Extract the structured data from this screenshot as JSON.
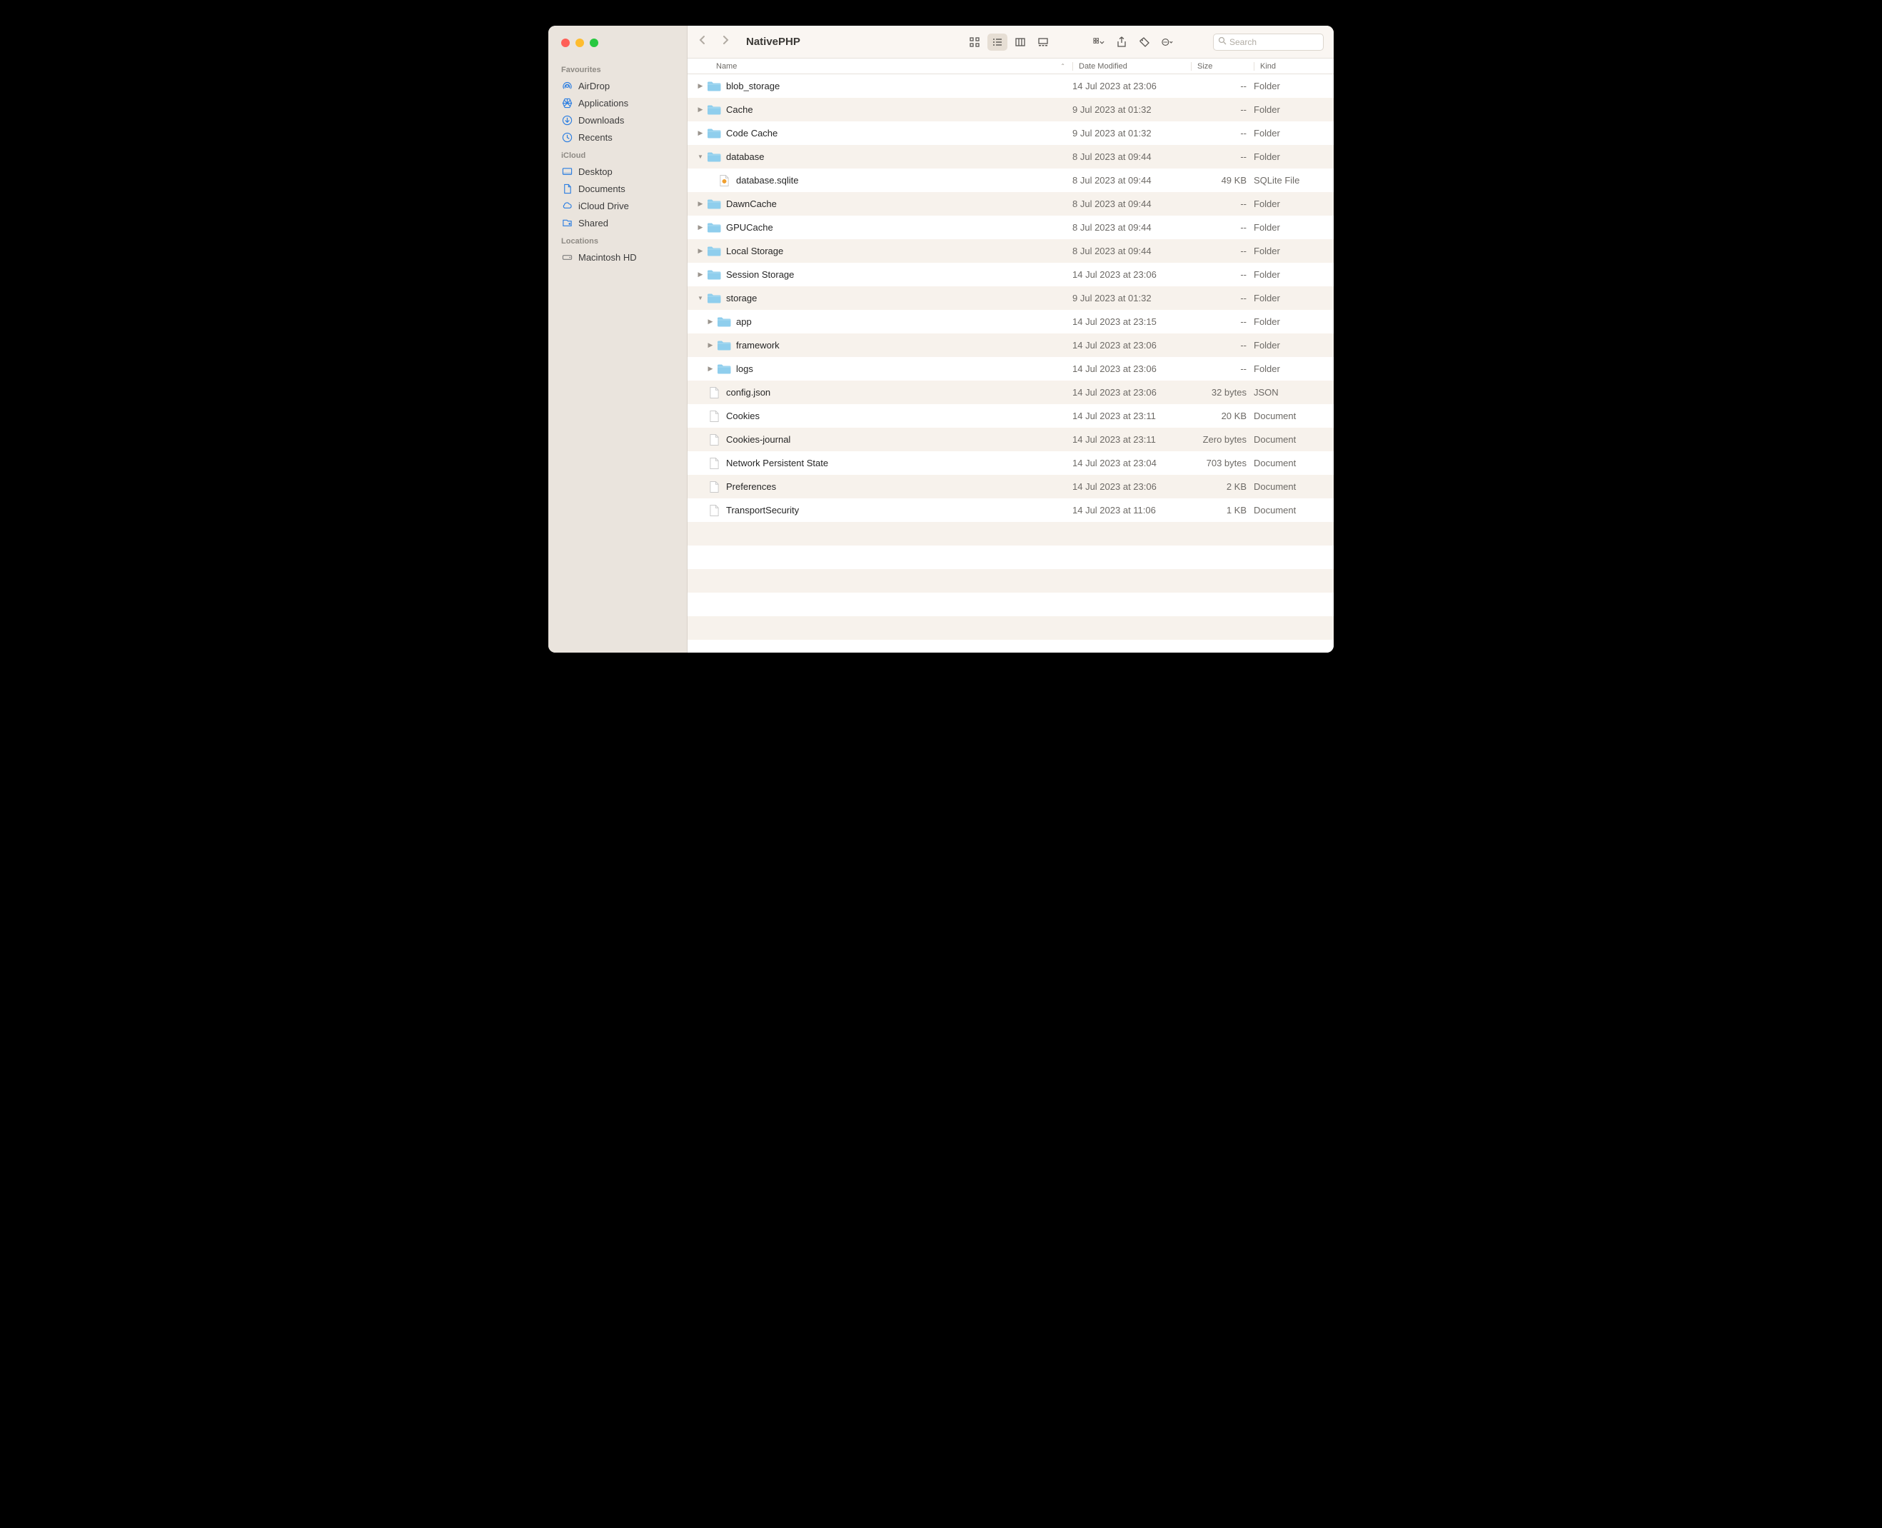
{
  "window": {
    "title": "NativePHP",
    "search_placeholder": "Search"
  },
  "sidebar": {
    "sections": [
      {
        "title": "Favourites",
        "items": [
          {
            "icon": "airdrop",
            "label": "AirDrop"
          },
          {
            "icon": "apps",
            "label": "Applications"
          },
          {
            "icon": "downloads",
            "label": "Downloads"
          },
          {
            "icon": "recents",
            "label": "Recents"
          }
        ]
      },
      {
        "title": "iCloud",
        "items": [
          {
            "icon": "desktop",
            "label": "Desktop"
          },
          {
            "icon": "documents",
            "label": "Documents"
          },
          {
            "icon": "icloud",
            "label": "iCloud Drive"
          },
          {
            "icon": "shared",
            "label": "Shared"
          }
        ]
      },
      {
        "title": "Locations",
        "items": [
          {
            "icon": "disk",
            "label": "Macintosh HD"
          }
        ]
      }
    ]
  },
  "columns": {
    "name": "Name",
    "date": "Date Modified",
    "size": "Size",
    "kind": "Kind"
  },
  "rows": [
    {
      "indent": 0,
      "expand": "closed",
      "icon": "folder",
      "name": "blob_storage",
      "date": "14 Jul 2023 at 23:06",
      "size": "--",
      "kind": "Folder"
    },
    {
      "indent": 0,
      "expand": "closed",
      "icon": "folder",
      "name": "Cache",
      "date": "9 Jul 2023 at 01:32",
      "size": "--",
      "kind": "Folder"
    },
    {
      "indent": 0,
      "expand": "closed",
      "icon": "folder",
      "name": "Code Cache",
      "date": "9 Jul 2023 at 01:32",
      "size": "--",
      "kind": "Folder"
    },
    {
      "indent": 0,
      "expand": "open",
      "icon": "folder",
      "name": "database",
      "date": "8 Jul 2023 at 09:44",
      "size": "--",
      "kind": "Folder"
    },
    {
      "indent": 1,
      "expand": "none",
      "icon": "sqlite",
      "name": "database.sqlite",
      "date": "8 Jul 2023 at 09:44",
      "size": "49 KB",
      "kind": "SQLite File"
    },
    {
      "indent": 0,
      "expand": "closed",
      "icon": "folder",
      "name": "DawnCache",
      "date": "8 Jul 2023 at 09:44",
      "size": "--",
      "kind": "Folder"
    },
    {
      "indent": 0,
      "expand": "closed",
      "icon": "folder",
      "name": "GPUCache",
      "date": "8 Jul 2023 at 09:44",
      "size": "--",
      "kind": "Folder"
    },
    {
      "indent": 0,
      "expand": "closed",
      "icon": "folder",
      "name": "Local Storage",
      "date": "8 Jul 2023 at 09:44",
      "size": "--",
      "kind": "Folder"
    },
    {
      "indent": 0,
      "expand": "closed",
      "icon": "folder",
      "name": "Session Storage",
      "date": "14 Jul 2023 at 23:06",
      "size": "--",
      "kind": "Folder"
    },
    {
      "indent": 0,
      "expand": "open",
      "icon": "folder",
      "name": "storage",
      "date": "9 Jul 2023 at 01:32",
      "size": "--",
      "kind": "Folder"
    },
    {
      "indent": 1,
      "expand": "closed",
      "icon": "folder",
      "name": "app",
      "date": "14 Jul 2023 at 23:15",
      "size": "--",
      "kind": "Folder"
    },
    {
      "indent": 1,
      "expand": "closed",
      "icon": "folder",
      "name": "framework",
      "date": "14 Jul 2023 at 23:06",
      "size": "--",
      "kind": "Folder"
    },
    {
      "indent": 1,
      "expand": "closed",
      "icon": "folder",
      "name": "logs",
      "date": "14 Jul 2023 at 23:06",
      "size": "--",
      "kind": "Folder"
    },
    {
      "indent": 0,
      "expand": "none",
      "icon": "file",
      "name": "config.json",
      "date": "14 Jul 2023 at 23:06",
      "size": "32 bytes",
      "kind": "JSON"
    },
    {
      "indent": 0,
      "expand": "none",
      "icon": "file",
      "name": "Cookies",
      "date": "14 Jul 2023 at 23:11",
      "size": "20 KB",
      "kind": "Document"
    },
    {
      "indent": 0,
      "expand": "none",
      "icon": "file",
      "name": "Cookies-journal",
      "date": "14 Jul 2023 at 23:11",
      "size": "Zero bytes",
      "kind": "Document"
    },
    {
      "indent": 0,
      "expand": "none",
      "icon": "file",
      "name": "Network Persistent State",
      "date": "14 Jul 2023 at 23:04",
      "size": "703 bytes",
      "kind": "Document"
    },
    {
      "indent": 0,
      "expand": "none",
      "icon": "file",
      "name": "Preferences",
      "date": "14 Jul 2023 at 23:06",
      "size": "2 KB",
      "kind": "Document"
    },
    {
      "indent": 0,
      "expand": "none",
      "icon": "file",
      "name": "TransportSecurity",
      "date": "14 Jul 2023 at 11:06",
      "size": "1 KB",
      "kind": "Document"
    }
  ]
}
